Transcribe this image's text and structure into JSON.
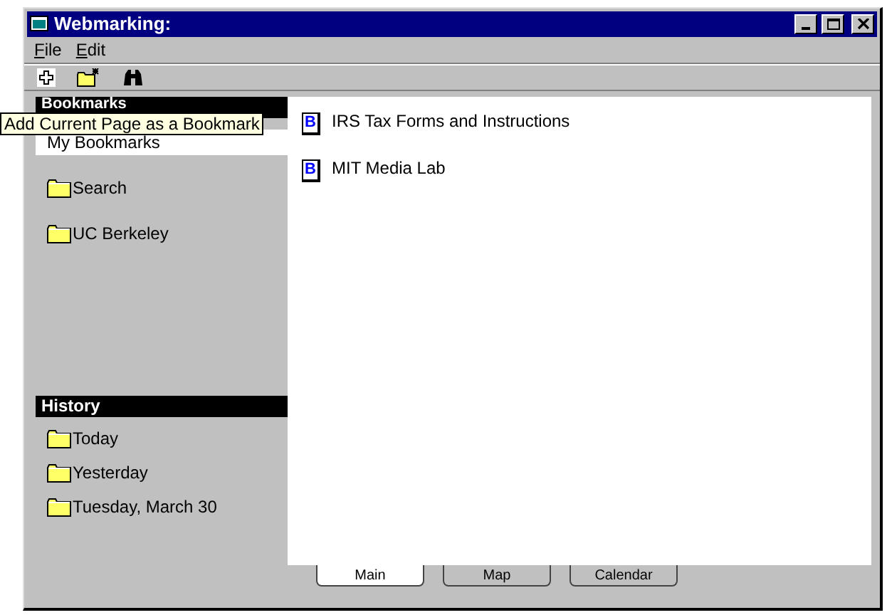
{
  "window": {
    "title": "Webmarking:"
  },
  "menu": [
    {
      "label": "File"
    },
    {
      "label": "Edit"
    }
  ],
  "tooltip": "Add Current Page as a Bookmark",
  "bookmarks": {
    "header": "Bookmarks",
    "items": [
      {
        "label": "My Bookmarks",
        "kind": "plain",
        "selected": true
      },
      {
        "label": "Search",
        "kind": "folder",
        "selected": false
      },
      {
        "label": "UC Berkeley",
        "kind": "folder",
        "selected": false
      }
    ]
  },
  "history": {
    "header": "History",
    "items": [
      {
        "label": "Today",
        "kind": "folder",
        "selected": false
      },
      {
        "label": "Yesterday",
        "kind": "folder",
        "selected": false
      },
      {
        "label": "Tuesday, March 30",
        "kind": "folder",
        "selected": false
      }
    ]
  },
  "content": [
    {
      "badge": "B",
      "label": "IRS Tax Forms and Instructions"
    },
    {
      "badge": "B",
      "label": "MIT Media Lab"
    }
  ],
  "tabs": [
    {
      "label": "Main",
      "selected": true
    },
    {
      "label": "Map",
      "selected": false
    },
    {
      "label": "Calendar",
      "selected": false
    }
  ]
}
